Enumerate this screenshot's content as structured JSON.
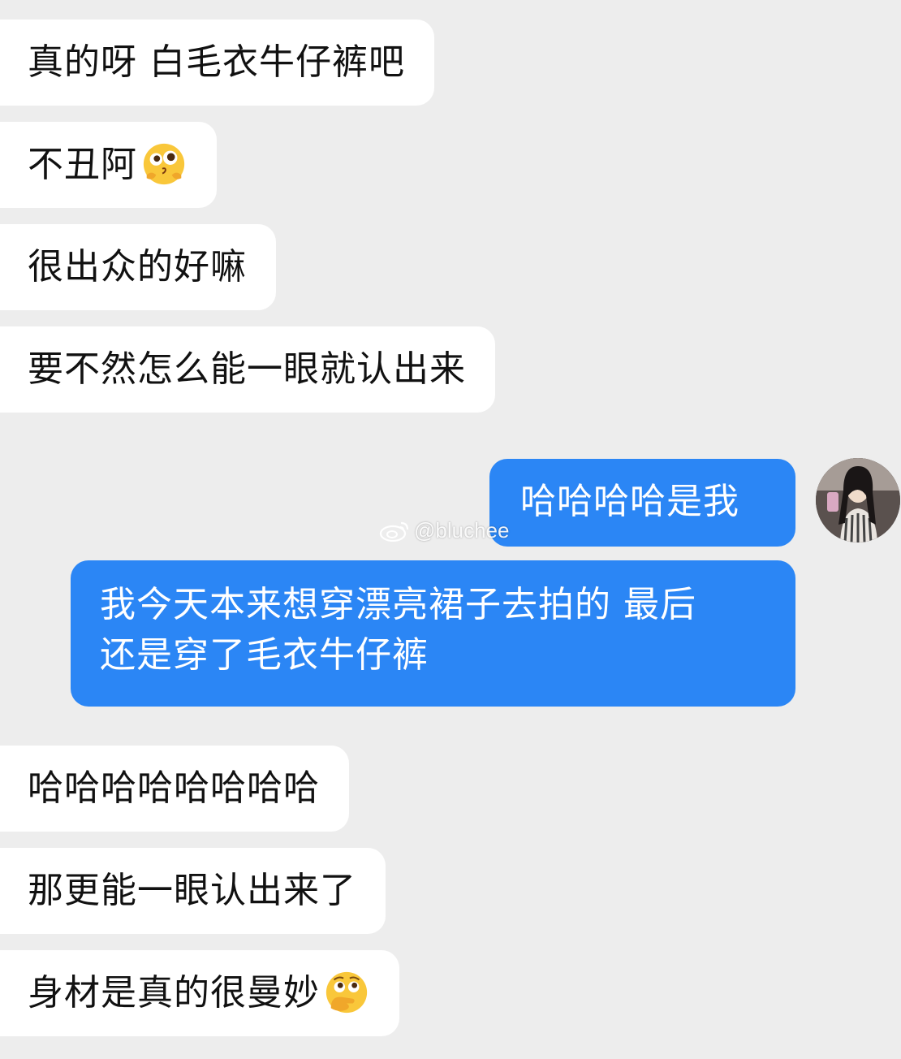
{
  "chat": {
    "messages": [
      {
        "side": "in",
        "text": "真的呀 白毛衣牛仔裤吧"
      },
      {
        "side": "in",
        "text": "不丑阿",
        "emoji": "pleading-face-emoji"
      },
      {
        "side": "in",
        "text": "很出众的好嘛"
      },
      {
        "side": "in",
        "text": "要不然怎么能一眼就认出来"
      },
      {
        "side": "out",
        "text": "哈哈哈哈是我"
      },
      {
        "side": "out",
        "line1": "我今天本来想穿漂亮裙子去拍的 最后",
        "line2": "还是穿了毛衣牛仔裤"
      },
      {
        "side": "in",
        "text": "哈哈哈哈哈哈哈哈"
      },
      {
        "side": "in",
        "text": "那更能一眼认出来了"
      },
      {
        "side": "in",
        "text": "身材是真的很曼妙",
        "emoji": "face-with-hand-over-mouth-emoji"
      }
    ]
  },
  "watermark": {
    "text": "@bluchee",
    "icon": "weibo-logo-icon"
  },
  "colors": {
    "background": "#ededed",
    "incoming_bubble": "#ffffff",
    "outgoing_bubble": "#2b86f5",
    "outgoing_text": "#ffffff"
  },
  "avatar": {
    "icon": "user-avatar-photo"
  }
}
